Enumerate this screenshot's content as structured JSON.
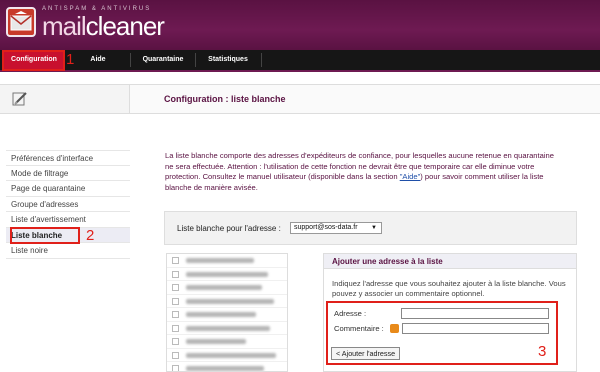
{
  "header": {
    "tagline": "ANTISPAM & ANTIVIRUS",
    "brand_prefix": "mail",
    "brand_suffix": "cleaner"
  },
  "nav": {
    "items": [
      {
        "label": "Configuration",
        "active": true
      },
      {
        "label": "Aide",
        "active": false
      },
      {
        "label": "Quarantaine",
        "active": false
      },
      {
        "label": "Statistiques",
        "active": false
      }
    ]
  },
  "page": {
    "title": "Configuration : liste blanche"
  },
  "sidebar": {
    "items": [
      {
        "label": "Préférences d'interface",
        "active": false
      },
      {
        "label": "Mode de filtrage",
        "active": false
      },
      {
        "label": "Page de quarantaine",
        "active": false
      },
      {
        "label": "Groupe d'adresses",
        "active": false
      },
      {
        "label": "Liste d'avertissement",
        "active": false
      },
      {
        "label": "Liste blanche",
        "active": true
      },
      {
        "label": "Liste noire",
        "active": false
      }
    ]
  },
  "intro": {
    "text_before_link": "La liste blanche comporte des adresses d'expéditeurs de confiance, pour lesquelles aucune retenue en quarantaine ne sera effectuée. Attention : l'utilisation de cette fonction ne devrait être que temporaire car elle diminue votre protection. Consultez le manuel utilisateur (disponible dans la section ",
    "link_text": "\"Aide\"",
    "text_after_link": ") pour savoir comment utiliser la liste blanche de manière avisée."
  },
  "selector": {
    "label": "Liste blanche pour l'adresse :",
    "selected_value": "support@sos-data.fr"
  },
  "add_panel": {
    "title": "Ajouter une adresse à la liste",
    "description": "Indiquez l'adresse que vous souhaitez ajouter à la liste blanche. Vous pouvez y associer un commentaire optionnel.",
    "address_label": "Adresse :",
    "address_value": "",
    "comment_label": "Commentaire :",
    "comment_value": "",
    "submit_label": "< Ajouter l'adresse"
  },
  "annotations": [
    "1",
    "2",
    "3"
  ],
  "colors": {
    "brand_purple": "#5a1242",
    "nav_active": "#c8102e",
    "annotation_red": "#e0201a"
  }
}
